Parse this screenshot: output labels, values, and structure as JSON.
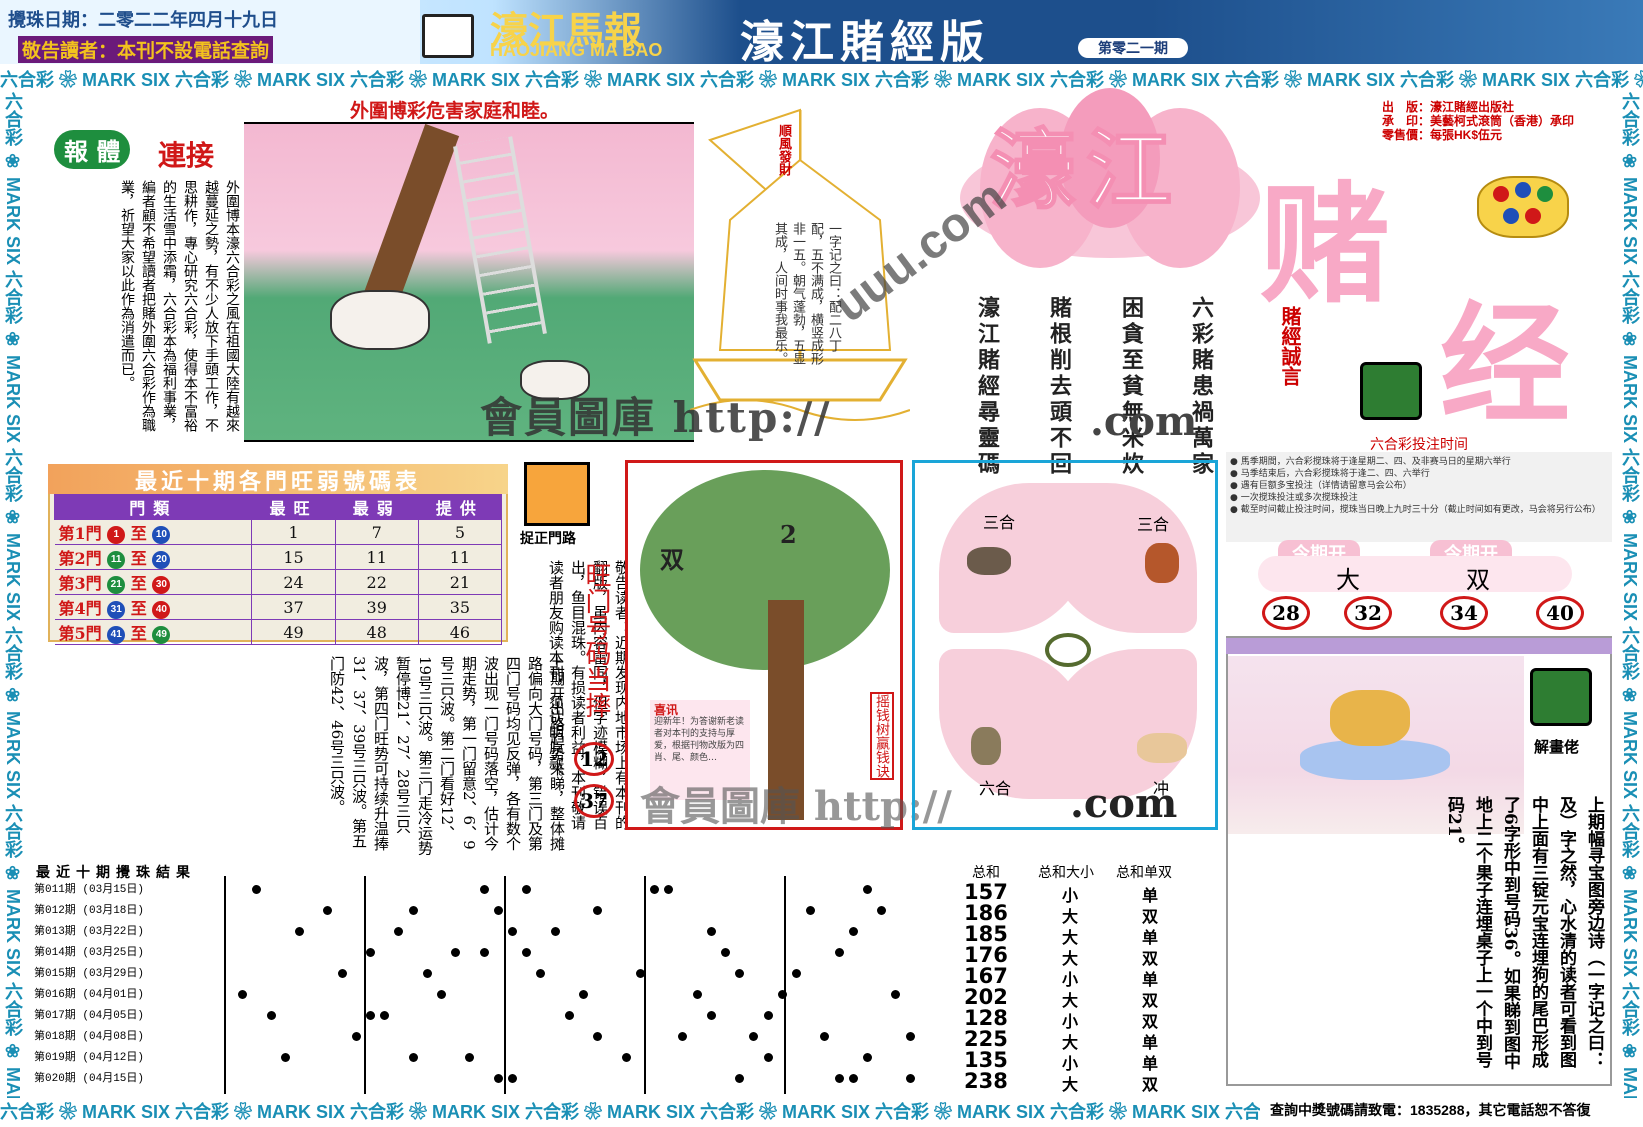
{
  "header": {
    "draw_date": "攪珠日期：二零二二年四月十九日",
    "notice": "敬告讀者：本刊不設電話查詢",
    "brand_cn": "濠江馬報",
    "brand_en": "HAOJIANG MA BAO",
    "edition_title": "濠江賭經版",
    "issue_no": "第零二一期"
  },
  "strip_text": "六合彩 ❀ MARK SIX 六合彩 ❀ MARK SIX 六合彩 ❀ MARK SIX 六合彩 ❀ MARK SIX 六合彩 ❀ MARK SIX 六合彩 ❀ MARK SIX 六合彩 ❀ MARK SIX 六合彩 ❀ MARK SIX 六合彩 ❀ MARK SIX 六合彩 ❀ MARK SIX",
  "hotline": "查詢中獎號碼請致電：1835288，其它電話恕不答復",
  "story": {
    "headline": "外圍博彩危害家庭和睦。",
    "label_a": "報 體",
    "label_b": "連接",
    "text": "外圍博本濠六合彩之風在祖國大陸有越來越蔓延之勢，有不少人放下手頭工作，不思耕作，專心研究六合彩，使得本不富裕的生活雪中添霜，六合彩本為福利事業，編者顧不希望讀者把賭外圍六合彩作為職業，祈望大家以此作為消遣而已。"
  },
  "boat": {
    "flag": "順風發財",
    "poem": "一字记之曰：配二八丁配，五不满成，横竖成形非一五。朝气蓬勃，五显其成，人间时事我最乐。"
  },
  "logo": {
    "haojiang": "濠江",
    "du": "赌",
    "jing": "经"
  },
  "publisher": {
    "line1": "出　版：濠江賭經出版社",
    "line2": "承　印：美藝柯式滾筒（香港）承印",
    "line3": "零售價：每張HK$伍元"
  },
  "maxims": {
    "title": "賭經誠言",
    "col1": "六彩賭患禍萬家",
    "col2": "困貪至貧無米炊",
    "col3": "賭根削去頭不回",
    "col4": "濠江賭經尋靈碼"
  },
  "watermark": {
    "main": "會員圖庫 http://",
    "diag_url": "uuu.com",
    "com": ".com",
    "tree_wm": "會員圖庫 http://"
  },
  "betting": {
    "label": "六合彩投注时间",
    "rules": [
      "● 馬季期間，六合彩搅珠将于逢星期二、四、及非赛马日的星期六举行",
      "● 马季结束后，六合彩搅珠将于逢二、四、六举行",
      "● 遇有巨额多宝投注（详情请留意马会公布）",
      "● 一次搅珠投注或多次搅珠投注",
      "● 截至时间截止投注时间，搅珠当日晚上九时三十分（截止时间如有更改，马会将另行公布）"
    ]
  },
  "hotcold": {
    "title": "最近十期各門旺弱號碼表",
    "headers": [
      "門類",
      "最旺",
      "最弱",
      "提供"
    ],
    "rows": [
      {
        "gate": "第1門",
        "from": "1",
        "to": "10",
        "hot": "1",
        "cold": "7",
        "tip": "5"
      },
      {
        "gate": "第2門",
        "from": "11",
        "to": "20",
        "hot": "15",
        "cold": "11",
        "tip": "11"
      },
      {
        "gate": "第3門",
        "from": "21",
        "to": "30",
        "hot": "24",
        "cold": "22",
        "tip": "21"
      },
      {
        "gate": "第4門",
        "from": "31",
        "to": "40",
        "hot": "37",
        "cold": "39",
        "tip": "35"
      },
      {
        "gate": "第5門",
        "from": "41",
        "to": "49",
        "hot": "49",
        "cold": "48",
        "tip": "46"
      }
    ],
    "connector": "至"
  },
  "catch": {
    "label": "捉正門路",
    "reader_notice": "敬告读者：近期发现内地市场上有本刊的翻版，虽内容雷同，但字迹模糊，错误百出，鱼目混珠。有损读者利益，本刊敬请读者朋友购读本刊，须认明原款。",
    "hot_title": "旺门号码当摔",
    "n1": "12",
    "n2": "37",
    "analysis": "上期开出路趋势来睇，整体摊路偏向大门号码，第三门及第四门号码均见反弹，各有数个波出现一门号码落空，估计今期走势，第一门留意2、6、9号三只波。第二门看好12、19号三只波。第三门走冷运势暂停博21、27、28号三只波，第四门旺势可持续升温捧31、37、39号三只波。第五门防42、46号三只波。"
  },
  "money_tree": {
    "left_label": "双",
    "right_label": "2",
    "side_label": "摇钱树赢钱诀",
    "note_title": "喜讯",
    "note_body": "迎新年！为答谢新老读者对本刊的支持与厚爱，根据刊物改版为四肖、尾、颜色…"
  },
  "zodiac": {
    "tl": "三合",
    "tr": "三合",
    "bl": "六合",
    "br": "冲",
    "url": ".com"
  },
  "this_period": {
    "head1": "今期开",
    "head2": "今期开",
    "val1": "大",
    "val2": "双",
    "nums": [
      "28",
      "32",
      "34",
      "40"
    ]
  },
  "puzzle": {
    "label": "解畫佬",
    "text": "上期幅寻宝图旁边诗（一字记之曰：及）字之然，心水清的读者可看到图中上面有三锭元宝连埋狗的尾巴形成了6字形中到号码36。如果睇到图中地上二个果子连埋桌子上一个中到号码21。"
  },
  "results": {
    "title": "最近十期攪珠結果",
    "sum_head": "总和",
    "size_head": "总和大小",
    "oe_head": "总和单双",
    "rows": [
      {
        "period": "第011期",
        "date": "(03月15日)",
        "sum": "157",
        "size": "小",
        "oe": "单",
        "dots": [
          3,
          19,
          22,
          31,
          32,
          46
        ]
      },
      {
        "period": "第012期",
        "date": "(03月18日)",
        "sum": "186",
        "size": "大",
        "oe": "双",
        "dots": [
          8,
          14,
          20,
          27,
          42,
          47
        ]
      },
      {
        "period": "第013期",
        "date": "(03月22日)",
        "sum": "185",
        "size": "大",
        "oe": "单",
        "dots": [
          6,
          13,
          21,
          24,
          35,
          45
        ]
      },
      {
        "period": "第014期",
        "date": "(03月25日)",
        "sum": "176",
        "size": "大",
        "oe": "双",
        "dots": [
          11,
          17,
          19,
          22,
          36,
          44
        ]
      },
      {
        "period": "第015期",
        "date": "(03月29日)",
        "sum": "167",
        "size": "小",
        "oe": "单",
        "dots": [
          9,
          15,
          23,
          30,
          37,
          41
        ]
      },
      {
        "period": "第016期",
        "date": "(04月01日)",
        "sum": "202",
        "size": "大",
        "oe": "双",
        "dots": [
          2,
          16,
          26,
          34,
          40,
          48
        ]
      },
      {
        "period": "第017期",
        "date": "(04月05日)",
        "sum": "128",
        "size": "小",
        "oe": "双",
        "dots": [
          4,
          11,
          12,
          25,
          35,
          39
        ]
      },
      {
        "period": "第018期",
        "date": "(04月08日)",
        "sum": "225",
        "size": "大",
        "oe": "单",
        "dots": [
          10,
          27,
          33,
          38,
          43,
          49
        ]
      },
      {
        "period": "第019期",
        "date": "(04月12日)",
        "sum": "135",
        "size": "小",
        "oe": "单",
        "dots": [
          5,
          14,
          18,
          29,
          39,
          46
        ]
      },
      {
        "period": "第020期",
        "date": "(04月15日)",
        "sum": "238",
        "size": "大",
        "oe": "双",
        "dots": [
          20,
          21,
          37,
          44,
          45,
          49
        ]
      }
    ]
  },
  "colors": {
    "red": "#d01818",
    "green": "#1e8e3e",
    "blue": "#1f4fb8",
    "purple": "#7e3ab6"
  }
}
